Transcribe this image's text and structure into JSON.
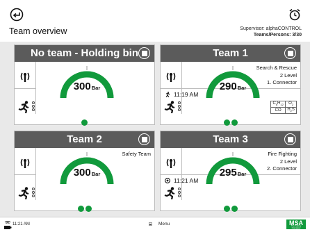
{
  "header": {
    "title": "Team overview",
    "supervisor": "Supervisor: alphaCONTROL",
    "teams_persons": "Teams/Persons: 3/30"
  },
  "panels": [
    {
      "name": "No team - Holding bin",
      "pressure": "300",
      "unit": "Bar",
      "info": [],
      "time": "",
      "time_icon": "",
      "gas": [],
      "status_dots": 1
    },
    {
      "name": "Team 1",
      "pressure": "290",
      "unit": "Bar",
      "info": [
        "Search & Rescue",
        "2 Level",
        "1. Connector"
      ],
      "time": "11:19 AM",
      "time_icon": "running-person-icon",
      "gas": [
        "C6H12",
        "O2",
        "CO",
        "H2S"
      ],
      "status_dots": 2
    },
    {
      "name": "Team 2",
      "pressure": "300",
      "unit": "Bar",
      "info": [
        "Safety Team"
      ],
      "time": "",
      "time_icon": "",
      "gas": [],
      "status_dots": 2
    },
    {
      "name": "Team 3",
      "pressure": "295",
      "unit": "Bar",
      "info": [
        "Fire Fighting",
        "2 Level",
        "2. Connector"
      ],
      "time": "11:21 AM",
      "time_icon": "target-icon",
      "gas": [],
      "status_dots": 2
    }
  ],
  "footer": {
    "time": "11:21 AM",
    "menu_label": "Menu",
    "logo_text": "MSA",
    "logo_tagline": "The Safety Company"
  },
  "colors": {
    "accent_green": "#119a3c",
    "header_gray": "#5b5b5b",
    "gauge_track": "#e5e5e5"
  }
}
